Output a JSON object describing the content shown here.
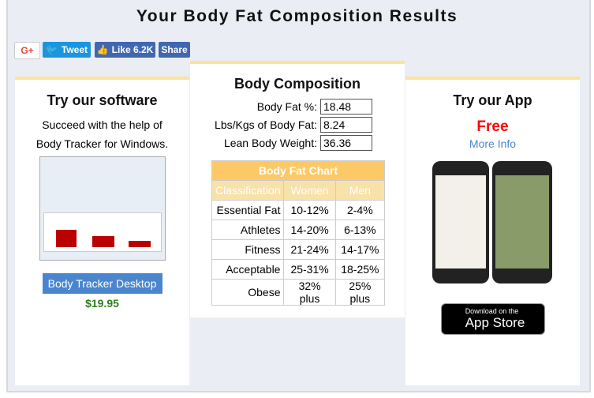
{
  "title": "Your Body Fat Composition Results",
  "social": {
    "gplus": "G+",
    "tweet": "Tweet",
    "like": "Like 6.2K",
    "share": "Share"
  },
  "left": {
    "heading": "Try our software",
    "text": "Succeed with the help of Body Tracker for Windows.",
    "button": "Body Tracker Desktop",
    "price": "$19.95"
  },
  "middle": {
    "heading": "Body Composition",
    "fields": [
      {
        "label": "Body Fat %:",
        "value": "18.48"
      },
      {
        "label": "Lbs/Kgs of Body Fat:",
        "value": "8.24"
      },
      {
        "label": "Lean Body Weight:",
        "value": "36.36"
      }
    ],
    "chart": {
      "title": "Body Fat Chart",
      "headers": [
        "Classification",
        "Women",
        "Men"
      ],
      "rows": [
        [
          "Essential Fat",
          "10-12%",
          "2-4%"
        ],
        [
          "Athletes",
          "14-20%",
          "6-13%"
        ],
        [
          "Fitness",
          "21-24%",
          "14-17%"
        ],
        [
          "Acceptable",
          "25-31%",
          "18-25%"
        ],
        [
          "Obese",
          "32% plus",
          "25% plus"
        ]
      ]
    }
  },
  "right": {
    "heading": "Try our App",
    "free": "Free",
    "more": "More Info",
    "store_small": "Download on the",
    "store_big": "App Store"
  },
  "colors": {
    "accent": "#fde29a",
    "free": "#ff0000",
    "price": "#2e7d1e",
    "button": "#4a86d0"
  }
}
